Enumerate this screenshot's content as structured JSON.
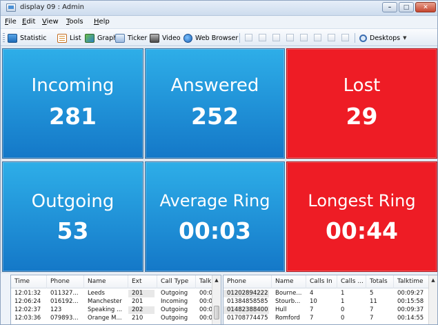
{
  "window": {
    "title": "display 09 : Admin"
  },
  "menu": [
    {
      "label": "File",
      "accel": "F",
      "rest": "ile"
    },
    {
      "label": "Edit",
      "accel": "E",
      "rest": "dit"
    },
    {
      "label": "View",
      "accel": "V",
      "rest": "iew"
    },
    {
      "label": "Tools",
      "accel": "T",
      "rest": "ools"
    },
    {
      "label": "Help",
      "accel": "H",
      "rest": "elp"
    }
  ],
  "toolbar": {
    "statistic": "Statistic",
    "list": "List",
    "graph": "Graph",
    "ticker": "Ticker",
    "video": "Video",
    "web_browser": "Web Browser",
    "desktops": "Desktops"
  },
  "tiles": [
    {
      "label": "Incoming",
      "value": "281",
      "color": "#1e93d8"
    },
    {
      "label": "Answered",
      "value": "252",
      "color": "#1e93d8"
    },
    {
      "label": "Lost",
      "value": "29",
      "color": "#ee1c25"
    },
    {
      "label": "Outgoing",
      "value": "53",
      "color": "#1e93d8"
    },
    {
      "label": "Average Ring",
      "value": "00:03",
      "color": "#1e93d8"
    },
    {
      "label": "Longest Ring",
      "value": "00:44",
      "color": "#ee1c25"
    }
  ],
  "calls_table": {
    "columns": [
      "Time",
      "Phone",
      "Name",
      "Ext",
      "Call Type",
      "Talk"
    ],
    "rows": [
      [
        "12:01:32",
        "011327...",
        "Leeds",
        "201",
        "Outgoing",
        "00:0"
      ],
      [
        "12:06:24",
        "016192...",
        "Manchester",
        "201",
        "Incoming",
        "00:0"
      ],
      [
        "12:02:37",
        "123",
        "Speaking ...",
        "202",
        "Outgoing",
        "00:0"
      ],
      [
        "12:03:36",
        "079893...",
        "Orange M...",
        "210",
        "Outgoing",
        "00:0"
      ]
    ]
  },
  "callers_table": {
    "columns": [
      "Phone",
      "Name",
      "Calls In",
      "Calls ...",
      "Totals",
      "Talktime"
    ],
    "rows": [
      [
        "01202894222",
        "Bourne...",
        "4",
        "1",
        "5",
        "00:09:27"
      ],
      [
        "01384858585",
        "Stourb...",
        "10",
        "1",
        "11",
        "00:15:58"
      ],
      [
        "01482388400",
        "Hull",
        "7",
        "0",
        "7",
        "00:09:37"
      ],
      [
        "01708774475",
        "Romford",
        "7",
        "0",
        "7",
        "00:14:55"
      ]
    ]
  }
}
